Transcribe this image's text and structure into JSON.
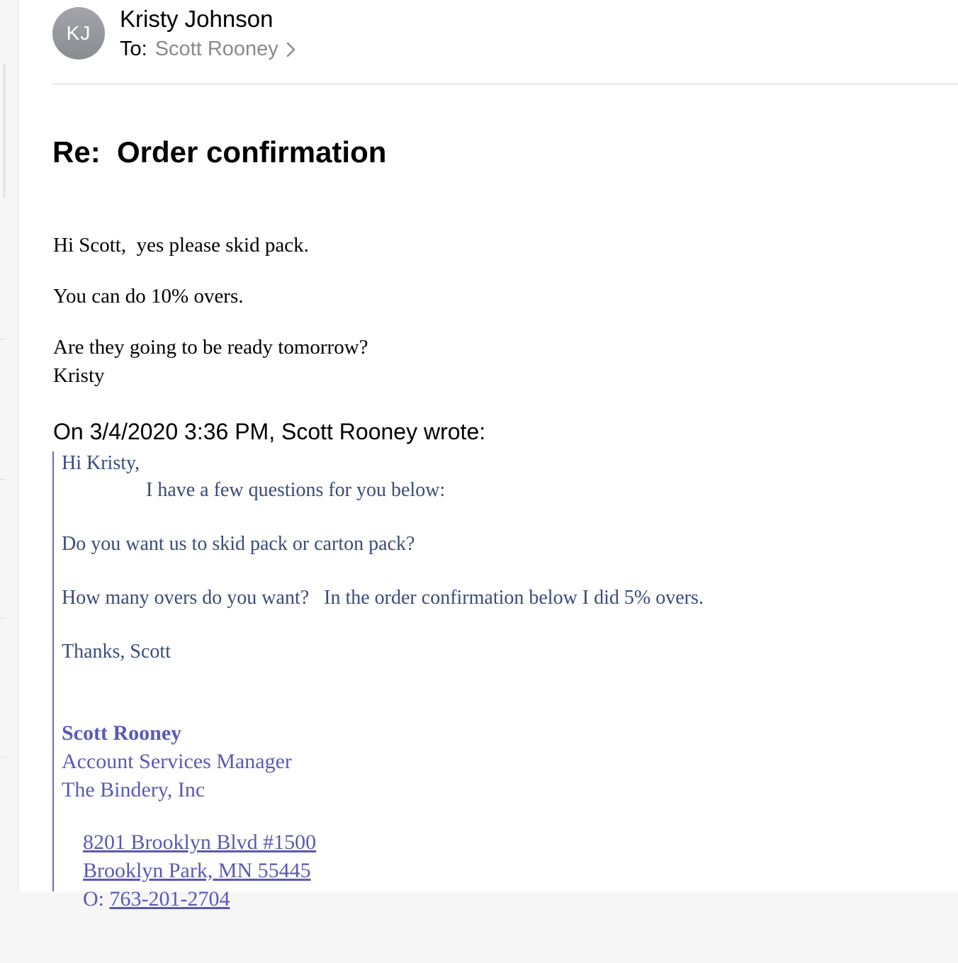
{
  "header": {
    "avatar_initials": "KJ",
    "sender_name": "Kristy Johnson",
    "to_label": "To:",
    "recipient": "Scott Rooney"
  },
  "subject": "Re:  Order confirmation",
  "reply": {
    "line1": "Hi Scott,  yes please skid pack.",
    "line2": "You can do 10% overs.",
    "line3": "Are they going to be ready tomorrow?",
    "line4": "Kristy"
  },
  "quoted": {
    "attribution": "On 3/4/2020 3:36 PM, Scott Rooney wrote:",
    "greeting": "Hi Kristy,",
    "intro": "I have a few questions for you below:",
    "question1": "Do you want us to skid pack or carton pack?",
    "question2": "How many overs do you want?   In the order confirmation below I did 5% overs.",
    "closing": "Thanks, Scott"
  },
  "signature": {
    "name": "Scott Rooney",
    "title": "Account Services Manager",
    "company": "The Bindery, Inc",
    "address1": "8201 Brooklyn Blvd #1500",
    "address2": "Brooklyn Park, MN 55445",
    "phone_label": "O: ",
    "phone": "763-201-2704"
  },
  "colors": {
    "quote_text": "#3b4a7a",
    "signature": "#5a59b6",
    "quote_bar": "#6c6bbf"
  }
}
